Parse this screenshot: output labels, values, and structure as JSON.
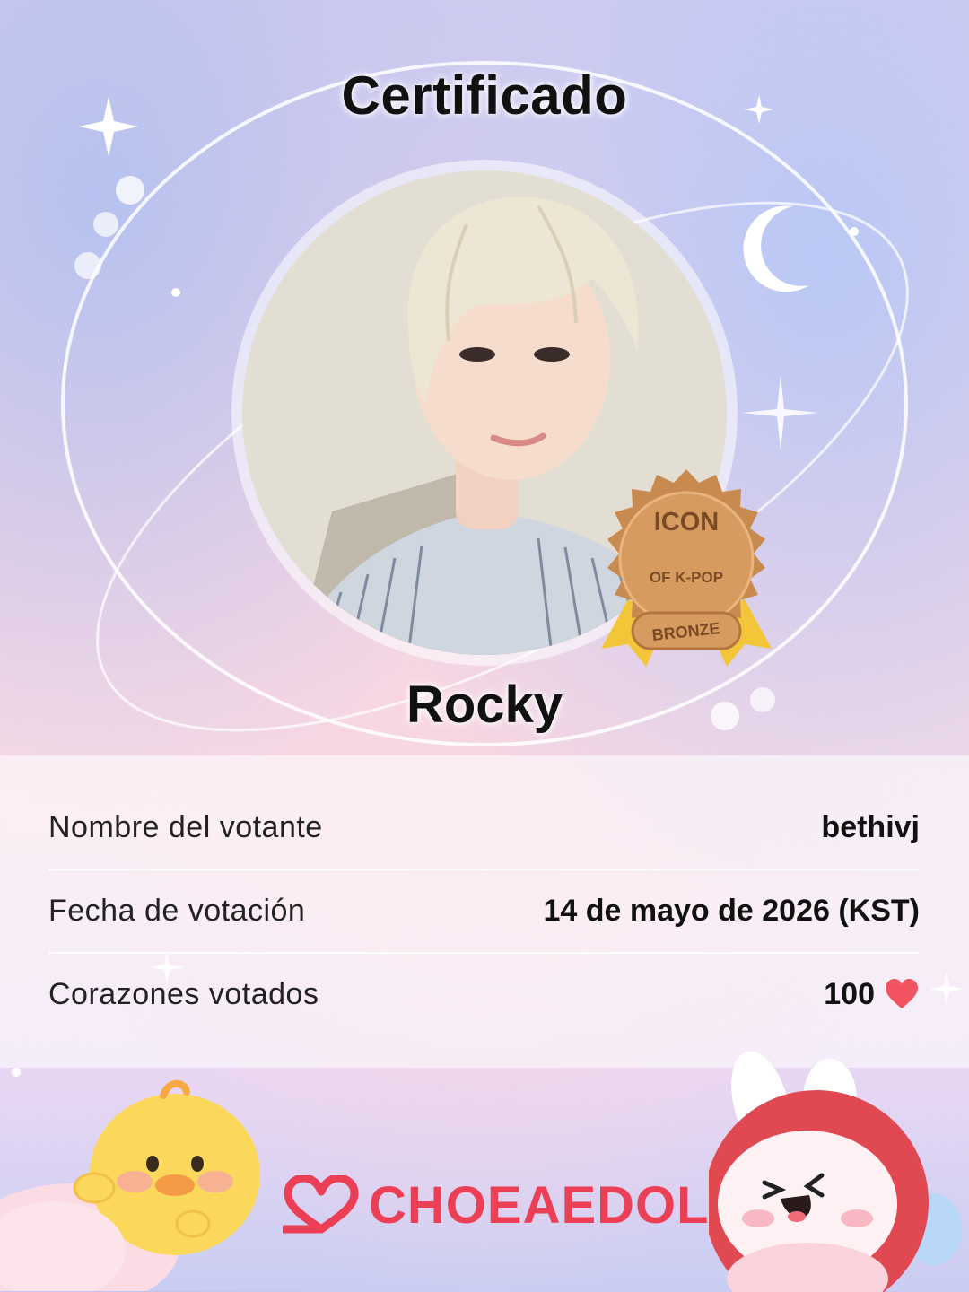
{
  "certificate": {
    "title": "Certificado",
    "idol_name": "Rocky",
    "badge": {
      "line1": "ICON",
      "line2": "OF K-POP",
      "tier": "BRONZE",
      "color": "#c98a4f"
    }
  },
  "details": [
    {
      "label": "Nombre del votante",
      "value": "bethivj"
    },
    {
      "label": "Fecha de votación",
      "value": "14 de mayo de 2026 (KST)"
    },
    {
      "label": "Corazones votados",
      "value": "100",
      "icon": "heart-icon"
    }
  ],
  "brand": {
    "name": "CHOEAEDOL",
    "color": "#ea3f55",
    "logo_icon": "choeaedol-heart-logo-icon"
  },
  "mascots": [
    "duck-mascot",
    "bunny-mascot"
  ]
}
